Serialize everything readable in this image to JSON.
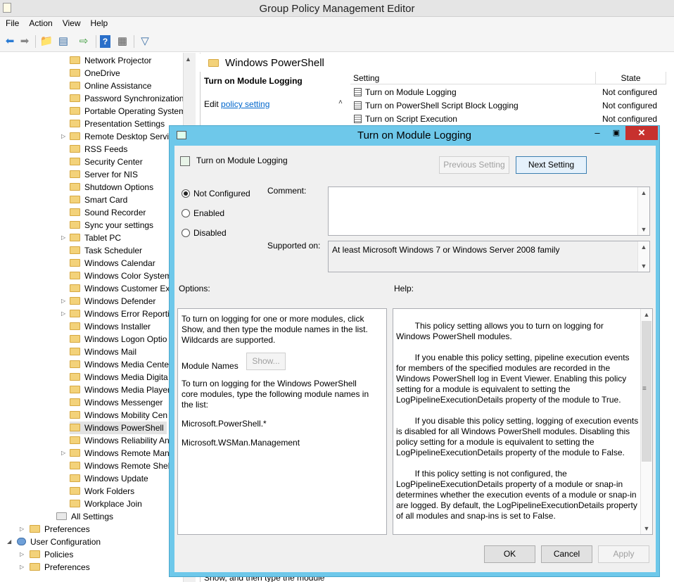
{
  "window": {
    "title": "Group Policy Management Editor"
  },
  "menu": [
    "File",
    "Action",
    "View",
    "Help"
  ],
  "tree": {
    "items": [
      "Network Projector",
      "OneDrive",
      "Online Assistance",
      "Password Synchronization",
      "Portable Operating System",
      "Presentation Settings",
      "Remote Desktop Servic",
      "RSS Feeds",
      "Security Center",
      "Server for NIS",
      "Shutdown Options",
      "Smart Card",
      "Sound Recorder",
      "Sync your settings",
      "Tablet PC",
      "Task Scheduler",
      "Windows Calendar",
      "Windows Color System",
      "Windows Customer Exp",
      "Windows Defender",
      "Windows Error Reportin",
      "Windows Installer",
      "Windows Logon Optio",
      "Windows Mail",
      "Windows Media Cente",
      "Windows Media Digita",
      "Windows Media Player",
      "Windows Messenger",
      "Windows Mobility Cen",
      "Windows PowerShell",
      "Windows Reliability An",
      "Windows Remote Man",
      "Windows Remote Shell",
      "Windows Update",
      "Work Folders",
      "Workplace Join"
    ],
    "all_settings": "All Settings",
    "preferences": "Preferences",
    "user_configuration": "User Configuration",
    "policies": "Policies",
    "preferences2": "Preferences"
  },
  "right_pane": {
    "header": "Windows PowerShell",
    "extended_title": "Turn on Module Logging",
    "edit_prefix": "Edit ",
    "edit_link": "policy setting",
    "col_setting": "Setting",
    "col_state": "State",
    "rows": [
      {
        "name": "Turn on Module Logging",
        "state": "Not configured"
      },
      {
        "name": "Turn on PowerShell Script Block Logging",
        "state": "Not configured"
      },
      {
        "name": "Turn on Script Execution",
        "state": "Not configured"
      }
    ],
    "bottom_text": "Show, and then type the module"
  },
  "dialog": {
    "title": "Turn on Module Logging",
    "setting_name": "Turn on Module Logging",
    "prev_button": "Previous Setting",
    "next_button": "Next Setting",
    "radio_not_configured": "Not Configured",
    "radio_enabled": "Enabled",
    "radio_disabled": "Disabled",
    "comment_label": "Comment:",
    "supported_label": "Supported on:",
    "supported_value": "At least Microsoft Windows 7 or Windows Server 2008 family",
    "options_label": "Options:",
    "help_label": "Help:",
    "options_text1": "To turn on logging for one or more modules, click\nShow, and then type the module names in the list.\nWildcards are supported.",
    "module_names_label": "Module Names",
    "show_button": "Show...",
    "options_text2": "To turn on logging for the Windows PowerShell\ncore modules, type the following module names in\nthe list:",
    "module1": "Microsoft.PowerShell.*",
    "module2": "Microsoft.WSMan.Management",
    "help_text": "        This policy setting allows you to turn on logging for\nWindows PowerShell modules.\n\n        If you enable this policy setting, pipeline execution events\nfor members of the specified modules are recorded in the\nWindows PowerShell log in Event Viewer. Enabling this policy\nsetting for a module is equivalent to setting the\nLogPipelineExecutionDetails property of the module to True.\n\n        If you disable this policy setting, logging of execution events\nis disabled for all Windows PowerShell modules. Disabling this\npolicy setting for a module is equivalent to setting the\nLogPipelineExecutionDetails property of the module to False.\n\n        If this policy setting is not configured, the\nLogPipelineExecutionDetails property of a module or snap-in\ndetermines whether the execution events of a module or snap-in\nare logged. By default, the LogPipelineExecutionDetails property\nof all modules and snap-ins is set to False.",
    "ok": "OK",
    "cancel": "Cancel",
    "apply": "Apply"
  },
  "colors": {
    "dialog_frame": "#6ec8ea",
    "close_button": "#c7312e",
    "folder": "#f3d27a",
    "link": "#0066cc"
  }
}
